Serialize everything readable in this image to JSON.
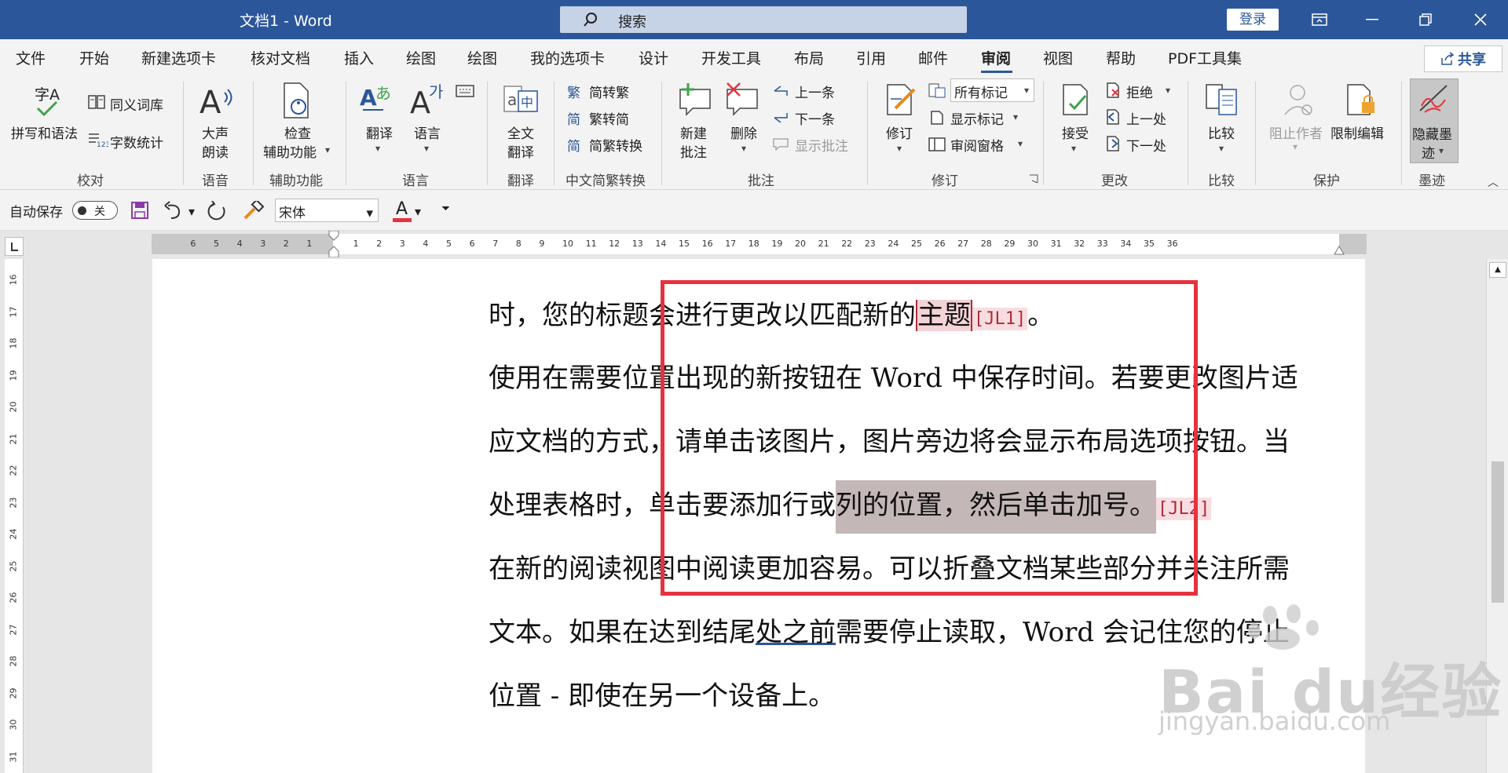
{
  "window": {
    "title": "文档1  -  Word",
    "search_placeholder": "搜索",
    "login_label": "登录"
  },
  "menu": {
    "tabs": [
      "文件",
      "开始",
      "新建选项卡",
      "核对文档",
      "插入",
      "绘图",
      "绘图",
      "我的选项卡",
      "设计",
      "开发工具",
      "布局",
      "引用",
      "邮件",
      "审阅",
      "视图",
      "帮助",
      "PDF工具集"
    ],
    "active_tab": "审阅",
    "share_label": "共享"
  },
  "ribbon": {
    "proofing": {
      "spell": "拼写和语法",
      "thesaurus": "同义词库",
      "wordcount": "字数统计",
      "big_icon_label": "字A",
      "group": "校对"
    },
    "speech": {
      "read_aloud_1": "大声",
      "read_aloud_2": "朗读",
      "group": "语音"
    },
    "accessibility": {
      "check_1": "检查",
      "check_2": "辅助功能",
      "group": "辅助功能"
    },
    "language": {
      "translate": "翻译",
      "language": "语言",
      "group": "语言"
    },
    "translation": {
      "full_1": "全文",
      "full_2": "翻译",
      "group": "翻译"
    },
    "chinese": {
      "to_trad": "简转繁",
      "to_simp": "繁转简",
      "convert": "简繁转换",
      "group": "中文简繁转换"
    },
    "comments": {
      "new_1": "新建",
      "new_2": "批注",
      "delete": "删除",
      "prev": "上一条",
      "next": "下一条",
      "show": "显示批注",
      "group": "批注"
    },
    "tracking": {
      "track": "修订",
      "markup_select": "所有标记",
      "show_markup": "显示标记",
      "pane": "审阅窗格",
      "group": "修订"
    },
    "changes": {
      "accept": "接受",
      "reject": "拒绝",
      "prev": "上一处",
      "next": "下一处",
      "group": "更改"
    },
    "compare": {
      "compare": "比较",
      "group": "比较"
    },
    "protect": {
      "block": "阻止作者",
      "restrict": "限制编辑",
      "group": "保护"
    },
    "ink": {
      "hide_1": "隐藏墨",
      "hide_2": "迹",
      "group": "墨迹"
    }
  },
  "qat": {
    "autosave": "自动保存",
    "toggle_state": "关",
    "font": "宋体"
  },
  "ruler": {
    "numbers": [
      "6",
      "5",
      "4",
      "3",
      "2",
      "1",
      "",
      "1",
      "2",
      "3",
      "4",
      "5",
      "6",
      "7",
      "8",
      "9",
      "10",
      "11",
      "12",
      "13",
      "14",
      "15",
      "16",
      "17",
      "18",
      "19",
      "20",
      "21",
      "22",
      "23",
      "24",
      "25",
      "26",
      "27",
      "28",
      "29",
      "30",
      "31",
      "32",
      "33",
      "34",
      "35",
      "36"
    ],
    "vnumbers": [
      "16",
      "17",
      "18",
      "19",
      "20",
      "21",
      "22",
      "23",
      "24",
      "25",
      "26",
      "27",
      "28",
      "29",
      "30",
      "31"
    ]
  },
  "document": {
    "l1_a": "时，您的标题会进行更改以匹配新的",
    "l1_hl": "主题",
    "l1_tag": "[JL1]",
    "l1_end": "。",
    "l2": "使用在需要位置出现的新按钮在 Word 中保存时间。若要更改图片适",
    "l3": "应文档的方式，请单击该图片，图片旁边将会显示布局选项按钮。当",
    "l4_a": "处理表格时，单击要添加行或",
    "l4_hl": "列的位置，然后单击加号。",
    "l4_tag": "[JL2]",
    "l5": "在新的阅读视图中阅读更加容易。可以折叠文档某些部分并关注所需",
    "l6_a": "文本。如果在达到结尾",
    "l6_ul": "处之前",
    "l6_b": "需要停止读取，Word 会记住您的停止",
    "l7": "位置 - 即使在另一个设备上。"
  },
  "watermark": {
    "brand": "Bai du经验",
    "url": "jingyan.baidu.com"
  }
}
